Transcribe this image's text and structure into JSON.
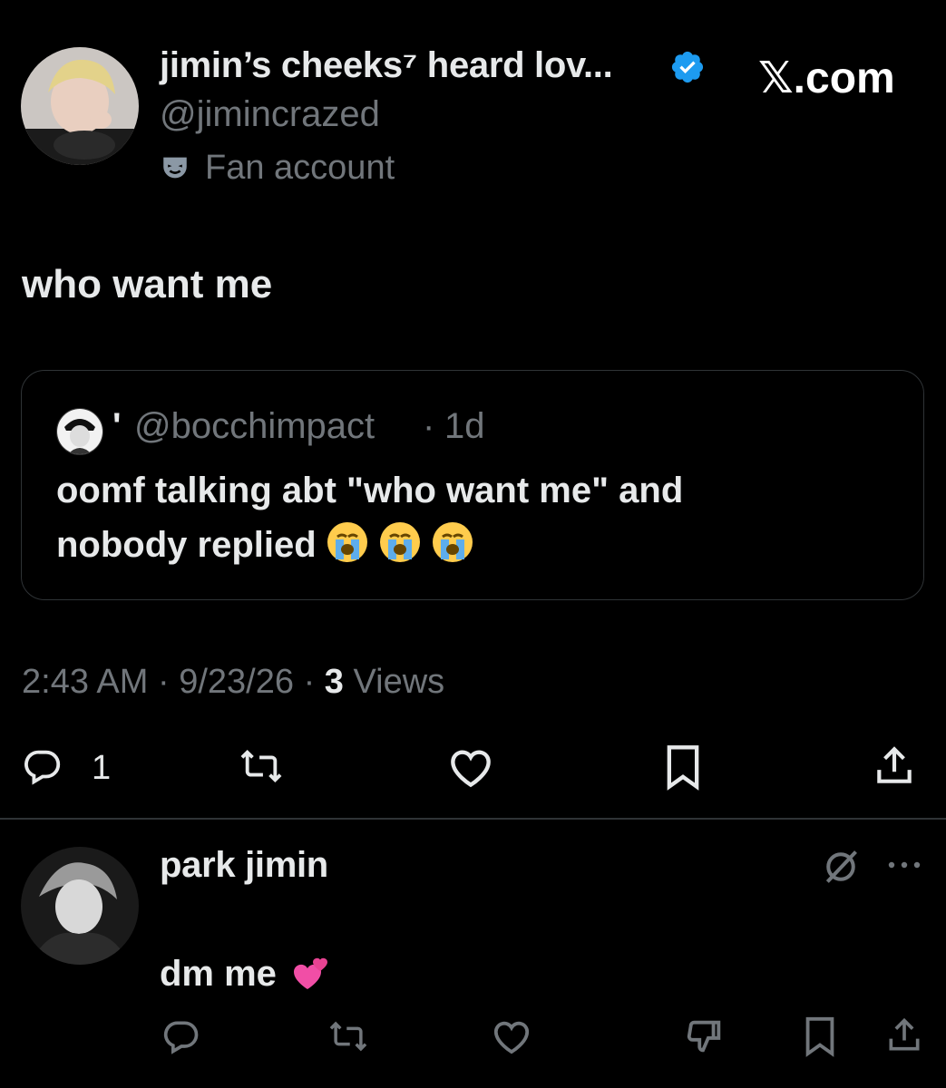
{
  "brand": {
    "watermark": "𝕏.com"
  },
  "tweet": {
    "author": {
      "display_name": "jimin’s cheeks⁷ heard lov...",
      "handle": "@jimincrazed",
      "label": "Fan account",
      "avatar_icon": "profile-photo",
      "verified_icon": "verified-badge-icon"
    },
    "text": "who want me",
    "quote": {
      "author_name": "'",
      "handle": "@bocchimpact",
      "separator": "·",
      "age": "1d",
      "text_line1": "oomf talking abt \"who want me\" and",
      "text_line2": "nobody replied",
      "emojis": [
        "loudly-crying-face",
        "loudly-crying-face",
        "loudly-crying-face"
      ]
    },
    "meta": {
      "time": "2:43 AM",
      "sep1": "·",
      "date": "9/23/26",
      "sep2": "·",
      "views_count": "3",
      "views_label": "Views"
    },
    "actions": {
      "reply_count": "1",
      "icons": [
        "reply-icon",
        "retweet-icon",
        "like-icon",
        "bookmark-icon",
        "share-icon"
      ]
    }
  },
  "reply": {
    "author": {
      "display_name": "park jimin",
      "avatar_icon": "profile-photo"
    },
    "text": "dm me",
    "emoji": "revolving-hearts",
    "top_icons": [
      "grok-icon",
      "more-icon"
    ],
    "actions": [
      "reply-icon",
      "retweet-icon",
      "like-icon",
      "dislike-icon",
      "bookmark-icon",
      "share-icon"
    ]
  },
  "colors": {
    "background": "#000000",
    "primary_text": "#e7e9ea",
    "secondary_text": "#71767b",
    "border": "#2f3336",
    "verified": "#1d9bf0"
  }
}
